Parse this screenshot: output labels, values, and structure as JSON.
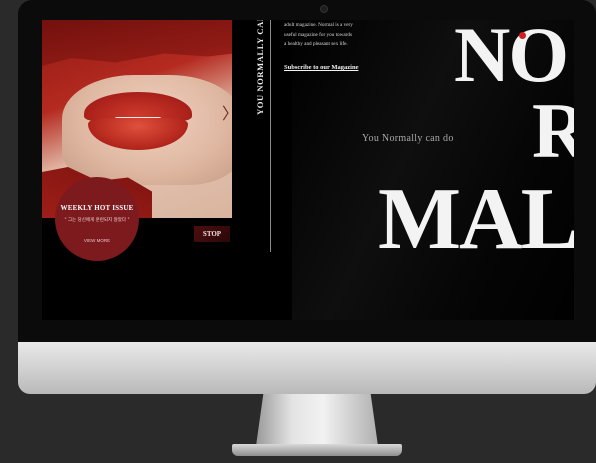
{
  "carousel": {
    "weekly_title": "WEEKLY HOT ISSUE",
    "weekly_quote": "\" 그는 당신에게 훈련되지 않았다 \"",
    "view_more": "VIEW MORE",
    "stop_label": "STOP",
    "next_glyph": "〉"
  },
  "tagline_vertical": "YOU NORMALLY CAN DO",
  "intro": {
    "lines": [
      "adult magazine. Normal is a very",
      "useful magazine for you towards",
      "a healthy and pleasant sex life."
    ]
  },
  "subscribe_link": "Subscribe to our Magazine",
  "slogan": "You Normally can do",
  "wordmark": {
    "line1": "NO",
    "line2": "R",
    "line3": "MAL"
  },
  "colors": {
    "accent_red": "#cf2020",
    "issue_circle": "#7d1a1d",
    "screen_bg": "#000000"
  }
}
